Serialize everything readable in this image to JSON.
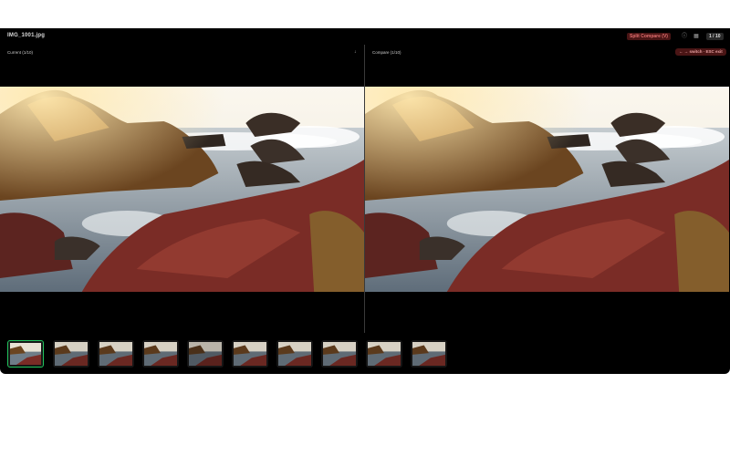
{
  "header": {
    "filename": "IMG_1001.jpg",
    "split_label": "Split Compare (V)",
    "counter": "1 / 10",
    "info_icon": "info-icon",
    "grid_icon": "grid-icon"
  },
  "panes": {
    "left_label": "Current (1/10)",
    "right_label": "Compare (1/10)",
    "download_icon": "download-icon",
    "switch_hint": "← → switch · ESC exit"
  },
  "thumbnails": {
    "count": 10,
    "active_index": 0,
    "active_color": "#22c55e"
  },
  "colors": {
    "accent_bg": "#4a1515",
    "accent_text": "#e07070"
  }
}
